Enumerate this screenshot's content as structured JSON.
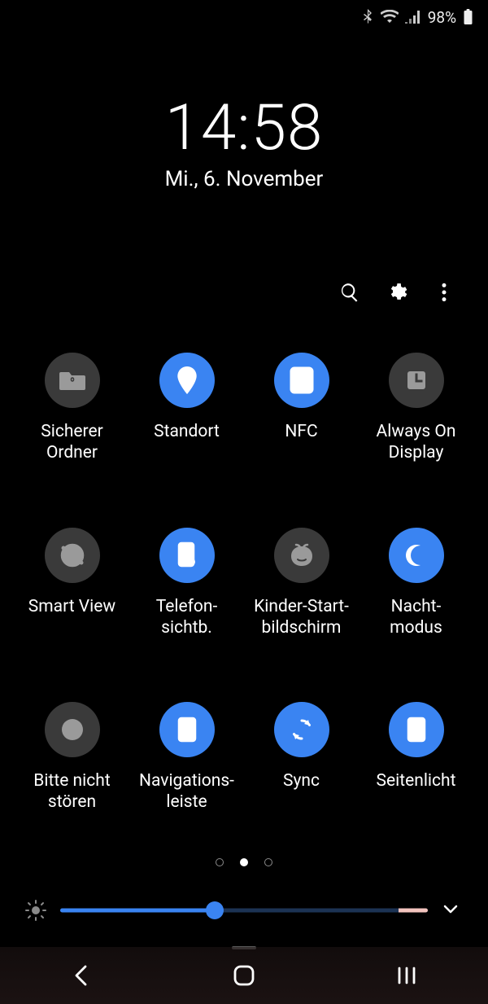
{
  "status": {
    "battery_pct": "98%",
    "bluetooth": true,
    "wifi": true,
    "signal": true
  },
  "clock": {
    "time": "14:58",
    "date": "Mi., 6. November"
  },
  "top_actions": {
    "search": "search-icon",
    "settings": "gear-icon",
    "more": "more-vert-icon"
  },
  "tiles": [
    {
      "id": "secure-folder",
      "label": "Sicherer\nOrdner",
      "active": false,
      "icon": "folder-lock-icon"
    },
    {
      "id": "location",
      "label": "Standort",
      "active": true,
      "icon": "location-pin-icon"
    },
    {
      "id": "nfc",
      "label": "NFC",
      "active": true,
      "icon": "nfc-icon"
    },
    {
      "id": "aod",
      "label": "Always On\nDisplay",
      "active": false,
      "icon": "clock-icon"
    },
    {
      "id": "smart-view",
      "label": "Smart View",
      "active": false,
      "icon": "cast-icon"
    },
    {
      "id": "phone-vis",
      "label": "Telefon-\nsichtb.",
      "active": true,
      "icon": "phone-visibility-icon"
    },
    {
      "id": "kids-home",
      "label": "Kinder-Start-\nbildschirm",
      "active": false,
      "icon": "kid-face-icon"
    },
    {
      "id": "night-mode",
      "label": "Nacht-\nmodus",
      "active": true,
      "icon": "moon-icon"
    },
    {
      "id": "dnd",
      "label": "Bitte nicht\nstören",
      "active": false,
      "icon": "dnd-icon"
    },
    {
      "id": "nav-bar",
      "label": "Navigations-\nleiste",
      "active": true,
      "icon": "navbar-icon"
    },
    {
      "id": "sync",
      "label": "Sync",
      "active": true,
      "icon": "sync-icon"
    },
    {
      "id": "edge-light",
      "label": "Seitenlicht",
      "active": true,
      "icon": "edge-light-icon"
    }
  ],
  "pagination": {
    "pages": 3,
    "current": 2
  },
  "brightness": {
    "value_pct": 42
  },
  "nav": {
    "back": "back",
    "home": "home",
    "recents": "recents"
  }
}
